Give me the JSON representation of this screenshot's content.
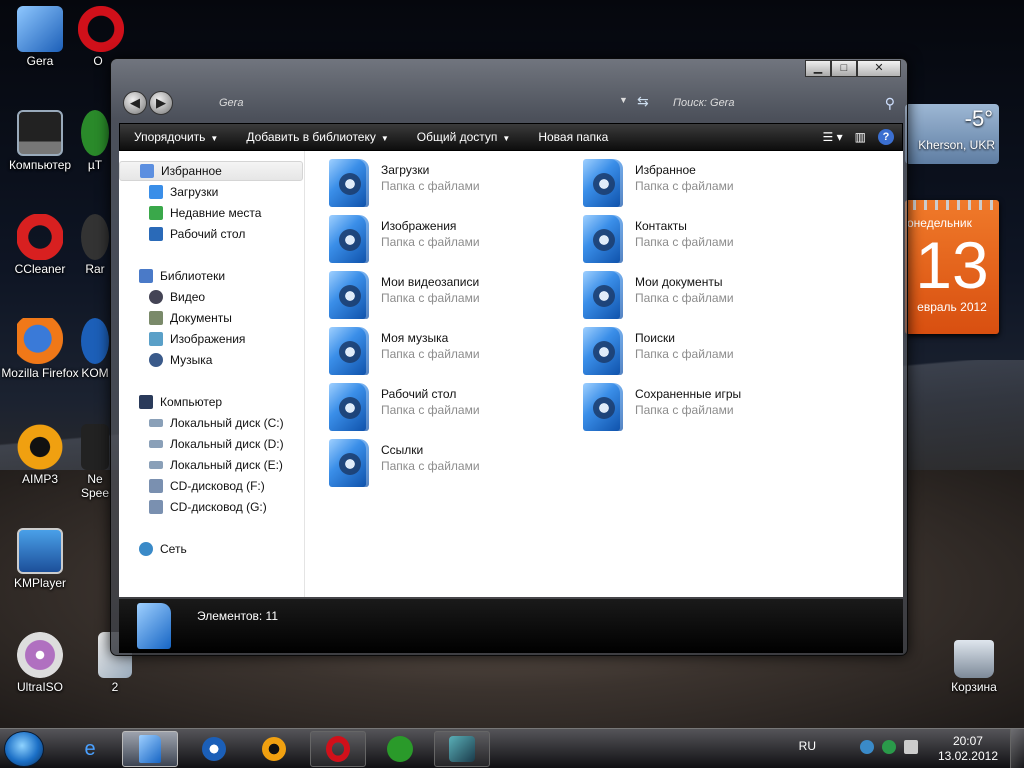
{
  "desktop": {
    "icons": [
      {
        "label": "Gera"
      },
      {
        "label": "O"
      },
      {
        "label": "Компьютер"
      },
      {
        "label": "µT"
      },
      {
        "label": "CCleaner"
      },
      {
        "label": "Rar"
      },
      {
        "label": "Mozilla Firefox"
      },
      {
        "label": "KOM"
      },
      {
        "label": "AIMP3"
      },
      {
        "label": "Ne Spee"
      },
      {
        "label": "KMPlayer"
      },
      {
        "label": "UltraISO"
      },
      {
        "label": "2"
      },
      {
        "label": "Корзина"
      }
    ],
    "weather": {
      "temp": "-5°",
      "location": "Kherson, UKR"
    },
    "calendar": {
      "weekday": "онедельник",
      "day": "13",
      "month": "евраль 2012"
    }
  },
  "window": {
    "caption": {
      "minimize": "▁",
      "maximize": "□",
      "close": "✕"
    },
    "address": {
      "back": "◀",
      "forward": "▶",
      "path": "Gera"
    },
    "search": {
      "placeholder": "Поиск: Gera"
    },
    "toolbar": {
      "organize": "Упорядочить",
      "add_library": "Добавить в библиотеку",
      "share": "Общий доступ",
      "new_folder": "Новая папка",
      "help": "?"
    },
    "nav": {
      "favorites": "Избранное",
      "downloads": "Загрузки",
      "recent": "Недавние места",
      "desktop": "Рабочий стол",
      "libraries": "Библиотеки",
      "video": "Видео",
      "documents": "Документы",
      "images": "Изображения",
      "music": "Музыка",
      "computer": "Компьютер",
      "disk_c": "Локальный диск (C:)",
      "disk_d": "Локальный диск (D:)",
      "disk_e": "Локальный диск (E:)",
      "cd_f": "CD-дисковод (F:)",
      "cd_g": "CD-дисковод (G:)",
      "network": "Сеть"
    },
    "folders": [
      {
        "name": "Загрузки",
        "desc": "Папка с файлами"
      },
      {
        "name": "Избранное",
        "desc": "Папка с файлами"
      },
      {
        "name": "Изображения",
        "desc": "Папка с файлами"
      },
      {
        "name": "Контакты",
        "desc": "Папка с файлами"
      },
      {
        "name": "Мои видеозаписи",
        "desc": "Папка с файлами"
      },
      {
        "name": "Мои документы",
        "desc": "Папка с файлами"
      },
      {
        "name": "Моя музыка",
        "desc": "Папка с файлами"
      },
      {
        "name": "Поиски",
        "desc": "Папка с файлами"
      },
      {
        "name": "Рабочий стол",
        "desc": "Папка с файлами"
      },
      {
        "name": "Сохраненные игры",
        "desc": "Папка с файлами"
      },
      {
        "name": "Ссылки",
        "desc": "Папка с файлами"
      }
    ],
    "details": {
      "count": "Элементов: 11"
    }
  },
  "taskbar": {
    "lang": "RU",
    "time": "20:07",
    "date": "13.02.2012"
  },
  "colors": {
    "accent": "#1b6fc6",
    "calendar": "#e8651c"
  }
}
